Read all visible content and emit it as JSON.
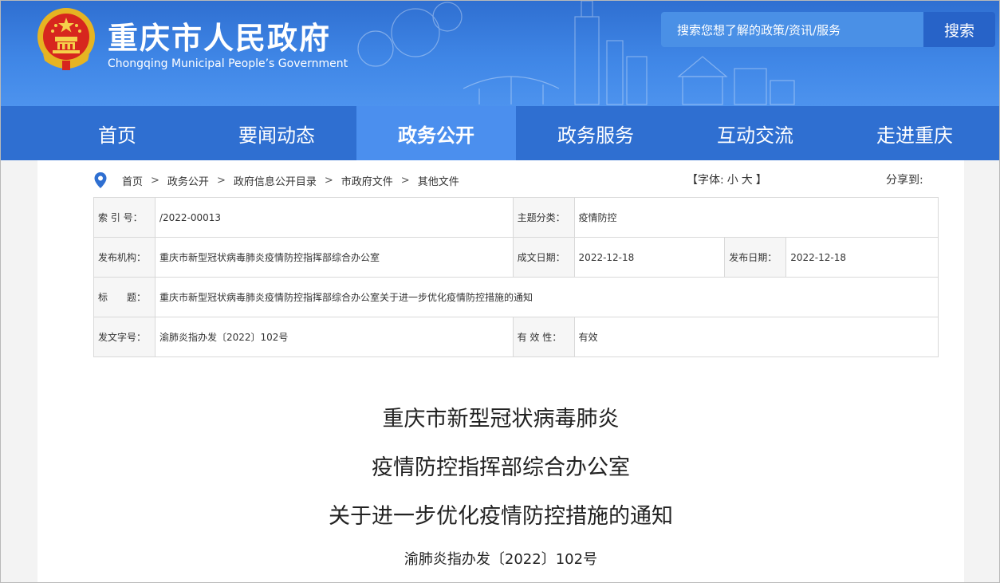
{
  "header": {
    "title": "重庆市人民政府",
    "subtitle": "Chongqing Municipal People’s Government",
    "search_placeholder": "搜索您想了解的政策/资讯/服务",
    "search_button": "搜索"
  },
  "nav": {
    "items": [
      {
        "label": "首页"
      },
      {
        "label": "要闻动态"
      },
      {
        "label": "政务公开",
        "active": true
      },
      {
        "label": "政务服务"
      },
      {
        "label": "互动交流"
      },
      {
        "label": "走进重庆"
      }
    ]
  },
  "breadcrumb": {
    "items": [
      "首页",
      "政务公开",
      "政府信息公开目录",
      "市政府文件",
      "其他文件"
    ],
    "separator": ">"
  },
  "font_size": {
    "open": "【字体:",
    "small": "小",
    "large": "大",
    "close": "】"
  },
  "share_label": "分享到:",
  "meta": {
    "index_label": "索 引 号：",
    "index_value": "/2022-00013",
    "topic_label": "主题分类：",
    "topic_value": "疫情防控",
    "issuer_label": "发布机构：",
    "issuer_value": "重庆市新型冠状病毒肺炎疫情防控指挥部综合办公室",
    "written_label": "成文日期：",
    "written_value": "2022-12-18",
    "published_label": "发布日期：",
    "published_value": "2022-12-18",
    "title_label": "标　　题：",
    "title_value": "重庆市新型冠状病毒肺炎疫情防控指挥部综合办公室关于进一步优化疫情防控措施的通知",
    "docno_label": "发文字号：",
    "docno_value": "渝肺炎指办发〔2022〕102号",
    "validity_label": "有 效 性：",
    "validity_value": "有效"
  },
  "document": {
    "title_line1": "重庆市新型冠状病毒肺炎",
    "title_line2": "疫情防控指挥部综合办公室",
    "title_line3": "关于进一步优化疫情防控措施的通知",
    "number": "渝肺炎指办发〔2022〕102号"
  },
  "colors": {
    "header_blue": "#2f6fd1",
    "nav_active": "#4b8fee",
    "search_button": "#2763c8"
  }
}
